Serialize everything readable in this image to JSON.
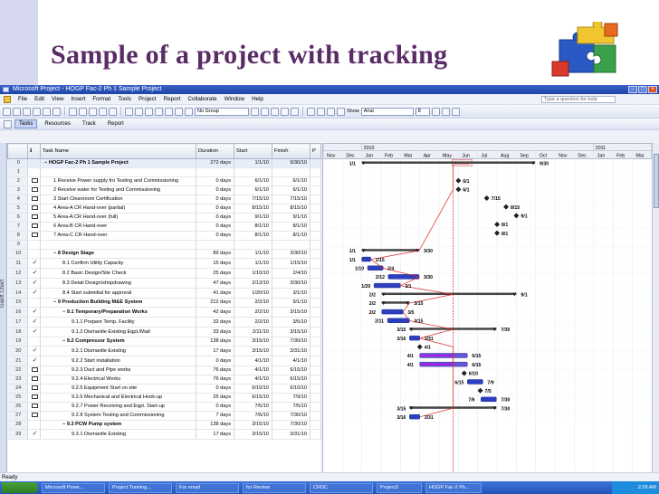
{
  "slide": {
    "title": "Sample of a project with tracking"
  },
  "window": {
    "title": "Microsoft Project - HOGP Fac-2 Ph 1 Sample Project",
    "menu": [
      "File",
      "Edit",
      "View",
      "Insert",
      "Format",
      "Tools",
      "Project",
      "Report",
      "Collaborate",
      "Window",
      "Help"
    ],
    "help_placeholder": "Type a question for help"
  },
  "toolbar": {
    "group": "No Group",
    "show": "Show",
    "font": "Arial",
    "font_size": "8"
  },
  "viewbar": {
    "tasks": "Tasks",
    "resources": "Resources",
    "track": "Track",
    "report": "Report"
  },
  "vertical_tab": "Gantt Chart",
  "columns": {
    "id": "",
    "info": "",
    "name": "Task Name",
    "duration": "Duration",
    "start": "Start",
    "finish": "Finish",
    "pred": "P"
  },
  "rows": [
    {
      "id": "0",
      "ind": "",
      "name": "HOGP Fac-2 Ph 1 Sample Project",
      "dur": "272 days",
      "start": "1/1/10",
      "finish": "9/30/10",
      "level": 0,
      "summary": true
    },
    {
      "id": "1",
      "ind": "",
      "name": "",
      "dur": "",
      "start": "",
      "finish": "",
      "level": 0,
      "summary": false
    },
    {
      "id": "2",
      "ind": "note",
      "name": "1 Receive Power supply fro Testing and Commissioning",
      "dur": "0 days",
      "start": "6/1/10",
      "finish": "6/1/10",
      "level": 1,
      "summary": false
    },
    {
      "id": "3",
      "ind": "note",
      "name": "2 Receive water for Testing and Commissioning",
      "dur": "0 days",
      "start": "6/1/10",
      "finish": "6/1/10",
      "level": 1,
      "summary": false
    },
    {
      "id": "4",
      "ind": "note",
      "name": "3 Start Cleanroom Certification",
      "dur": "0 days",
      "start": "7/15/10",
      "finish": "7/15/10",
      "level": 1,
      "summary": false
    },
    {
      "id": "5",
      "ind": "note",
      "name": "4 Area-A CR Hand-over (partial)",
      "dur": "0 days",
      "start": "8/15/10",
      "finish": "8/15/10",
      "level": 1,
      "summary": false
    },
    {
      "id": "6",
      "ind": "note",
      "name": "5 Area-A CR Hand-over (full)",
      "dur": "0 days",
      "start": "9/1/10",
      "finish": "9/1/10",
      "level": 1,
      "summary": false
    },
    {
      "id": "7",
      "ind": "note",
      "name": "6 Area-B CR Hand-over",
      "dur": "0 days",
      "start": "8/1/10",
      "finish": "8/1/10",
      "level": 1,
      "summary": false
    },
    {
      "id": "8",
      "ind": "note",
      "name": "7 Area-C CR Hand-over",
      "dur": "0 days",
      "start": "8/1/10",
      "finish": "8/1/10",
      "level": 1,
      "summary": false
    },
    {
      "id": "9",
      "ind": "",
      "name": "",
      "dur": "",
      "start": "",
      "finish": "",
      "level": 0,
      "summary": false
    },
    {
      "id": "10",
      "ind": "",
      "name": "8 Design Stage",
      "dur": "89 days",
      "start": "1/1/10",
      "finish": "3/30/10",
      "level": 1,
      "summary": true
    },
    {
      "id": "11",
      "ind": "check",
      "name": "8.1 Confirm Utility Capacity",
      "dur": "15 days",
      "start": "1/1/10",
      "finish": "1/15/10",
      "level": 2,
      "summary": false
    },
    {
      "id": "12",
      "ind": "check",
      "name": "8.2 Basic Design/Site Check",
      "dur": "25 days",
      "start": "1/10/10",
      "finish": "2/4/10",
      "level": 2,
      "summary": false
    },
    {
      "id": "13",
      "ind": "check",
      "name": "8.3 Detail Design/shopdrawing",
      "dur": "47 days",
      "start": "2/12/10",
      "finish": "3/30/10",
      "level": 2,
      "summary": false
    },
    {
      "id": "14",
      "ind": "check",
      "name": "8.4 Start submittal for approval",
      "dur": "41 days",
      "start": "1/20/10",
      "finish": "3/1/10",
      "level": 2,
      "summary": false
    },
    {
      "id": "15",
      "ind": "",
      "name": "9 Production Building M&E System",
      "dur": "212 days",
      "start": "2/2/10",
      "finish": "9/1/10",
      "level": 1,
      "summary": true
    },
    {
      "id": "16",
      "ind": "check",
      "name": "9.1 Temporary/Preparation Works",
      "dur": "42 days",
      "start": "2/2/10",
      "finish": "3/15/10",
      "level": 2,
      "summary": true
    },
    {
      "id": "17",
      "ind": "check",
      "name": "9.1.1 Prepare Temp. Facility",
      "dur": "32 days",
      "start": "2/2/10",
      "finish": "3/5/10",
      "level": 3,
      "summary": false
    },
    {
      "id": "18",
      "ind": "check",
      "name": "9.1.2 Dismantle Existing Eqpt./Matl",
      "dur": "33 days",
      "start": "2/11/10",
      "finish": "3/15/10",
      "level": 3,
      "summary": false
    },
    {
      "id": "19",
      "ind": "",
      "name": "9.2 Compressor System",
      "dur": "138 days",
      "start": "3/15/10",
      "finish": "7/30/10",
      "level": 2,
      "summary": true
    },
    {
      "id": "20",
      "ind": "check",
      "name": "9.2.1 Dismantle Existing",
      "dur": "17 days",
      "start": "3/15/10",
      "finish": "3/31/10",
      "level": 3,
      "summary": false
    },
    {
      "id": "21",
      "ind": "check",
      "name": "9.2.2 Start installation",
      "dur": "0 days",
      "start": "4/1/10",
      "finish": "4/1/10",
      "level": 3,
      "summary": false
    },
    {
      "id": "22",
      "ind": "note",
      "name": "9.2.3 Duct and Pipe works",
      "dur": "76 days",
      "start": "4/1/10",
      "finish": "6/15/10",
      "level": 3,
      "summary": false
    },
    {
      "id": "23",
      "ind": "note",
      "name": "9.2.4 Electrical Works",
      "dur": "76 days",
      "start": "4/1/10",
      "finish": "6/15/10",
      "level": 3,
      "summary": false
    },
    {
      "id": "24",
      "ind": "note",
      "name": "9.2.5 Equipment Start on site",
      "dur": "0 days",
      "start": "6/10/10",
      "finish": "6/10/10",
      "level": 3,
      "summary": false
    },
    {
      "id": "25",
      "ind": "note",
      "name": "9.2.6 Mechanical and Electrical Hook-up",
      "dur": "25 days",
      "start": "6/15/10",
      "finish": "7/9/10",
      "level": 3,
      "summary": false
    },
    {
      "id": "26",
      "ind": "note",
      "name": "9.2.7 Power Receiving and Eqpt. Start-up",
      "dur": "0 days",
      "start": "7/5/10",
      "finish": "7/5/10",
      "level": 3,
      "summary": false
    },
    {
      "id": "27",
      "ind": "note",
      "name": "9.2.8 System Testing and Commissioning",
      "dur": "7 days",
      "start": "7/6/10",
      "finish": "7/30/10",
      "level": 3,
      "summary": false
    },
    {
      "id": "28",
      "ind": "",
      "name": "9.3 PCW Pump system",
      "dur": "138 days",
      "start": "3/15/10",
      "finish": "7/30/10",
      "level": 2,
      "summary": true
    },
    {
      "id": "29",
      "ind": "check",
      "name": "9.3.1 Dismantle Existing",
      "dur": "17 days",
      "start": "3/15/10",
      "finish": "3/31/10",
      "level": 3,
      "summary": false
    }
  ],
  "timescale": {
    "years": [
      {
        "label": "2010",
        "start": "Jan"
      },
      {
        "label": "2011",
        "start": "Jan"
      }
    ],
    "months": [
      "Nov",
      "Dec",
      "Jan",
      "Feb",
      "Mar",
      "Apr",
      "May",
      "Jun",
      "Jul",
      "Aug",
      "Sep",
      "Oct",
      "Nov",
      "Dec",
      "Jan",
      "Feb",
      "Mar"
    ],
    "status_date": "5/23/10"
  },
  "gantt_labels": [
    {
      "row": 0,
      "left": "1/1",
      "right": "9/30"
    },
    {
      "row": 2,
      "right": "6/1"
    },
    {
      "row": 3,
      "right": "6/1"
    },
    {
      "row": 4,
      "right": "7/15"
    },
    {
      "row": 5,
      "right": "8/15"
    },
    {
      "row": 6,
      "right": "9/1"
    },
    {
      "row": 7,
      "right": "8/1"
    },
    {
      "row": 8,
      "right": "8/1"
    },
    {
      "row": 10,
      "left": "1/1",
      "right": "3/30"
    },
    {
      "row": 11,
      "left": "1/1",
      "right": "1/15"
    },
    {
      "row": 12,
      "left": "1/10",
      "right": "2/4"
    },
    {
      "row": 13,
      "left": "2/12",
      "right": "3/30"
    },
    {
      "row": 14,
      "left": "1/20",
      "right": "3/1"
    },
    {
      "row": 15,
      "left": "2/2",
      "right": "9/1"
    },
    {
      "row": 16,
      "left": "2/2",
      "right": "3/15"
    },
    {
      "row": 17,
      "left": "2/2",
      "right": "3/5"
    },
    {
      "row": 18,
      "left": "2/11",
      "right": "3/15"
    },
    {
      "row": 19,
      "left": "3/15",
      "right": "7/30"
    },
    {
      "row": 20,
      "left": "3/16",
      "right": "3/31"
    },
    {
      "row": 21,
      "right": "4/1"
    },
    {
      "row": 22,
      "left": "4/1",
      "right": "6/15"
    },
    {
      "row": 23,
      "left": "4/1",
      "right": "6/15"
    },
    {
      "row": 24,
      "right": "6/10"
    },
    {
      "row": 25,
      "left": "6/15",
      "right": "7/9"
    },
    {
      "row": 26,
      "right": "7/5"
    },
    {
      "row": 27,
      "left": "7/6",
      "right": "7/30"
    },
    {
      "row": 28,
      "left": "3/15",
      "right": "7/30"
    },
    {
      "row": 29,
      "left": "3/16",
      "right": "3/31"
    }
  ],
  "status": "Ready",
  "taskbar": {
    "items": [
      "Microsoft Powe...",
      "Project Training...",
      "For email",
      "for Review",
      "CRDC",
      "Project2",
      "HOGP Fac-2 Ph..."
    ],
    "clock": "2:28 AM"
  }
}
